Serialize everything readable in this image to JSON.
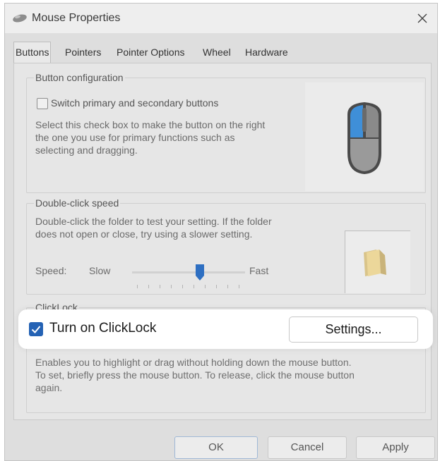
{
  "window": {
    "title": "Mouse Properties",
    "close_glyph": "✕",
    "icon": "mouse-icon"
  },
  "tabs": [
    "Buttons",
    "Pointers",
    "Pointer Options",
    "Wheel",
    "Hardware"
  ],
  "active_tab": "Buttons",
  "button_config": {
    "title": "Button configuration",
    "checkbox_label": "Switch primary and secondary buttons",
    "checked": false,
    "description_lines": [
      "Select this check box to make the button on the right",
      "the one you use for primary functions such as",
      "selecting and dragging."
    ]
  },
  "double_click": {
    "title": "Double-click speed",
    "description_lines": [
      "Double-click the folder to test your setting. If the folder",
      "does not open or close, try using a slower setting."
    ],
    "speed_label": "Speed:",
    "slow_label": "Slow",
    "fast_label": "Fast",
    "speed_value_fraction": 0.6
  },
  "clicklock": {
    "title": "ClickLock",
    "checkbox_label": "Turn on ClickLock",
    "checked": true,
    "settings_label": "Settings...",
    "description_lines": [
      "Enables you to highlight or drag without holding down the mouse button.",
      "To set, briefly press the mouse button. To release, click the mouse button",
      "again."
    ]
  },
  "footer": {
    "ok_label": "OK",
    "cancel_label": "Cancel",
    "apply_label": "Apply"
  },
  "colors": {
    "accent": "#2462b4",
    "mouse_highlight": "#3f8fd8"
  }
}
